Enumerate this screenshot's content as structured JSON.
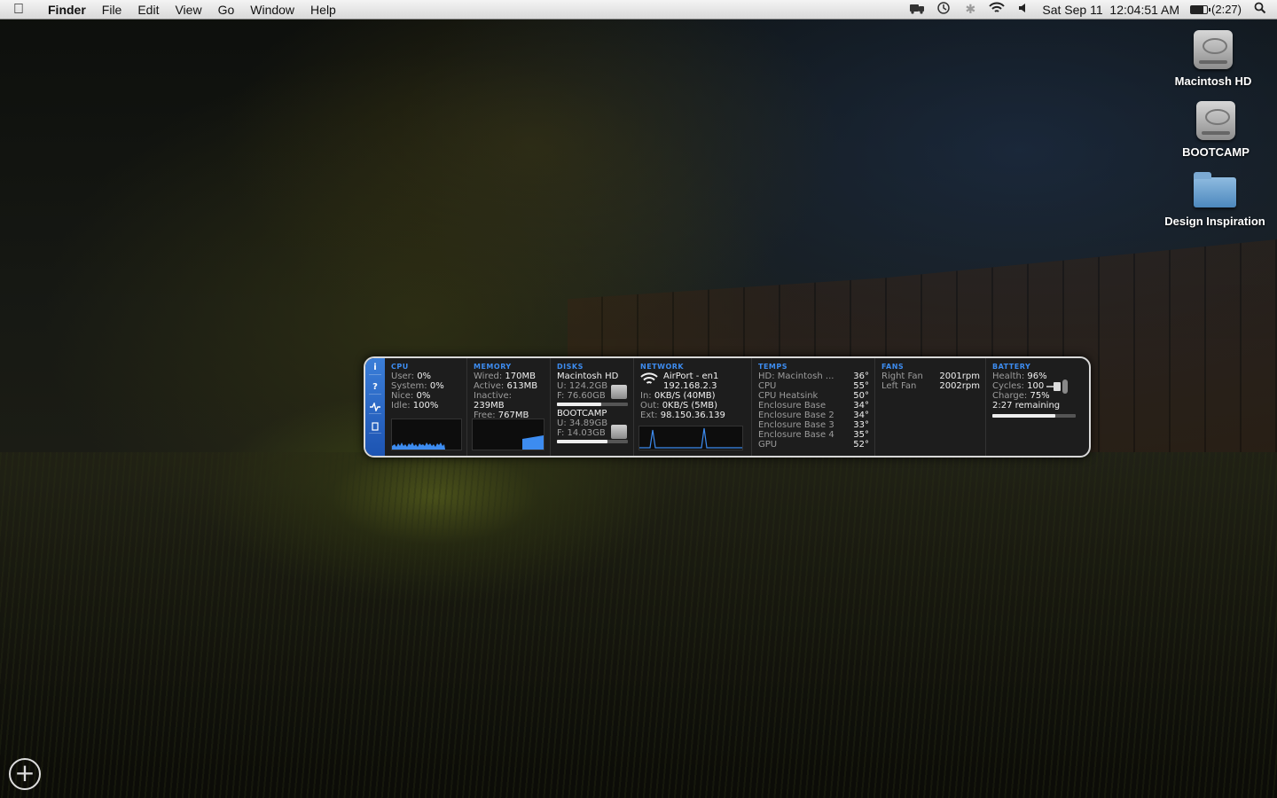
{
  "menubar": {
    "app_name": "Finder",
    "menus": [
      "File",
      "Edit",
      "View",
      "Go",
      "Window",
      "Help"
    ],
    "status_icons": [
      "istat-icon",
      "time-machine-icon",
      "bluetooth-icon",
      "wifi-icon",
      "volume-icon"
    ],
    "clock": "Sat Sep 11  12:04:51 AM",
    "battery_time": "(2:27)",
    "battery_level": 0.75
  },
  "desktop_icons": [
    {
      "label": "Macintosh HD",
      "type": "drive"
    },
    {
      "label": "BOOTCAMP",
      "type": "drive"
    },
    {
      "label": "Design Inspiration",
      "type": "folder"
    }
  ],
  "istat": {
    "sidebar": [
      "i",
      "?",
      "+",
      "▯"
    ],
    "cpu": {
      "title": "CPU",
      "user_label": "User:",
      "user_val": "0%",
      "system_label": "System:",
      "system_val": "0%",
      "nice_label": "Nice:",
      "nice_val": "0%",
      "idle_label": "Idle:",
      "idle_val": "100%"
    },
    "memory": {
      "title": "MEMORY",
      "wired_label": "Wired:",
      "wired_val": "170MB",
      "active_label": "Active:",
      "active_val": "613MB",
      "inactive_label": "Inactive:",
      "inactive_val": "239MB",
      "free_label": "Free:",
      "free_val": "767MB"
    },
    "disks": {
      "title": "DISKS",
      "disk1_name": "Macintosh HD",
      "disk1_used": "U: 124.2GB",
      "disk1_free": "F: 76.60GB",
      "disk1_used_fraction": 0.62,
      "disk2_name": "BOOTCAMP",
      "disk2_used": "U: 34.89GB",
      "disk2_free": "F: 14.03GB",
      "disk2_used_fraction": 0.71
    },
    "network": {
      "title": "NETWORK",
      "interface": "AirPort - en1",
      "ip": "192.168.2.3",
      "in_label": "In:",
      "in_val": "0KB/S (40MB)",
      "out_label": "Out:",
      "out_val": "0KB/S (5MB)",
      "ext_label": "Ext:",
      "ext_val": "98.150.36.139"
    },
    "temps": {
      "title": "TEMPS",
      "rows": [
        {
          "name": "HD: Macintosh ...",
          "val": "36°"
        },
        {
          "name": "CPU",
          "val": "55°"
        },
        {
          "name": "CPU Heatsink",
          "val": "50°"
        },
        {
          "name": "Enclosure Base",
          "val": "34°"
        },
        {
          "name": "Enclosure Base 2",
          "val": "34°"
        },
        {
          "name": "Enclosure Base 3",
          "val": "33°"
        },
        {
          "name": "Enclosure Base 4",
          "val": "35°"
        },
        {
          "name": "GPU",
          "val": "52°"
        }
      ]
    },
    "fans": {
      "title": "FANS",
      "rows": [
        {
          "name": "Right Fan",
          "val": "2001rpm"
        },
        {
          "name": "Left Fan",
          "val": "2002rpm"
        }
      ]
    },
    "battery": {
      "title": "BATTERY",
      "health_label": "Health:",
      "health_val": "96%",
      "cycles_label": "Cycles:",
      "cycles_val": "100",
      "charge_label": "Charge:",
      "charge_val": "75%",
      "remaining": "2:27 remaining",
      "charge_fraction": 0.75
    }
  },
  "dashboard_button": "+"
}
